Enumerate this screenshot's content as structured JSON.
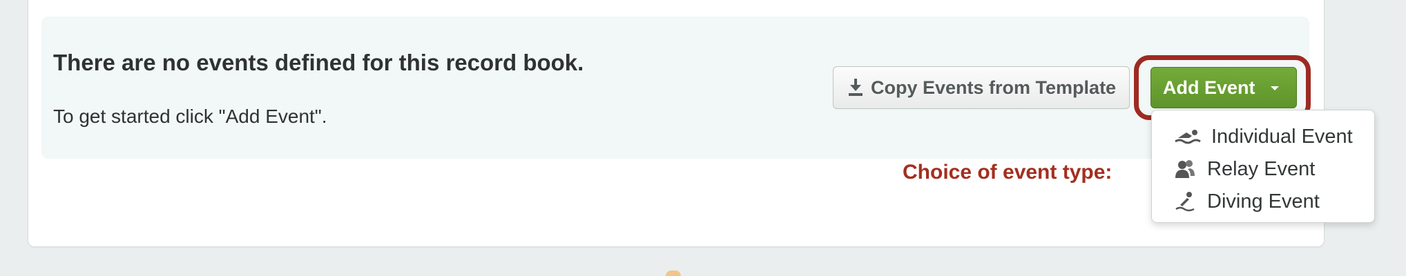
{
  "empty_state": {
    "title": "There are no events defined for this record book.",
    "message": "To get started click \"Add Event\"."
  },
  "toolbar": {
    "copy_button": {
      "label": "Copy Events from Template",
      "icon": "download-icon"
    },
    "add_button": {
      "label": "Add Event",
      "icon": "caret-down-icon"
    }
  },
  "annotation": {
    "text": "Choice of event type:",
    "color": "#a32f1f"
  },
  "dropdown": {
    "items": [
      {
        "label": "Individual Event",
        "icon": "swimmer-icon"
      },
      {
        "label": "Relay Event",
        "icon": "relay-swimmers-icon"
      },
      {
        "label": "Diving Event",
        "icon": "diver-icon"
      }
    ]
  },
  "colors": {
    "page_background": "#eaeeee",
    "empty_box_background": "#f2f7f7",
    "add_button_green": "#6aa033",
    "highlight_border": "#9e2a22"
  }
}
